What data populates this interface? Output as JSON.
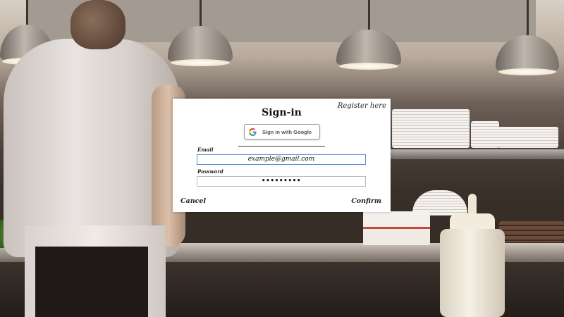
{
  "dialog": {
    "title": "Sign-in",
    "register_link": "Register here",
    "google_button_label": "Sign in with Google",
    "email_label": "Email",
    "email_value": "example@gmail.com",
    "password_label": "Password",
    "password_value": "•••••••••",
    "cancel_label": "Cancel",
    "confirm_label": "Confirm"
  },
  "icons": {
    "google": "google-g-icon"
  },
  "colors": {
    "dialog_bg": "#ffffff",
    "email_focus_border": "#5b8fd8"
  }
}
